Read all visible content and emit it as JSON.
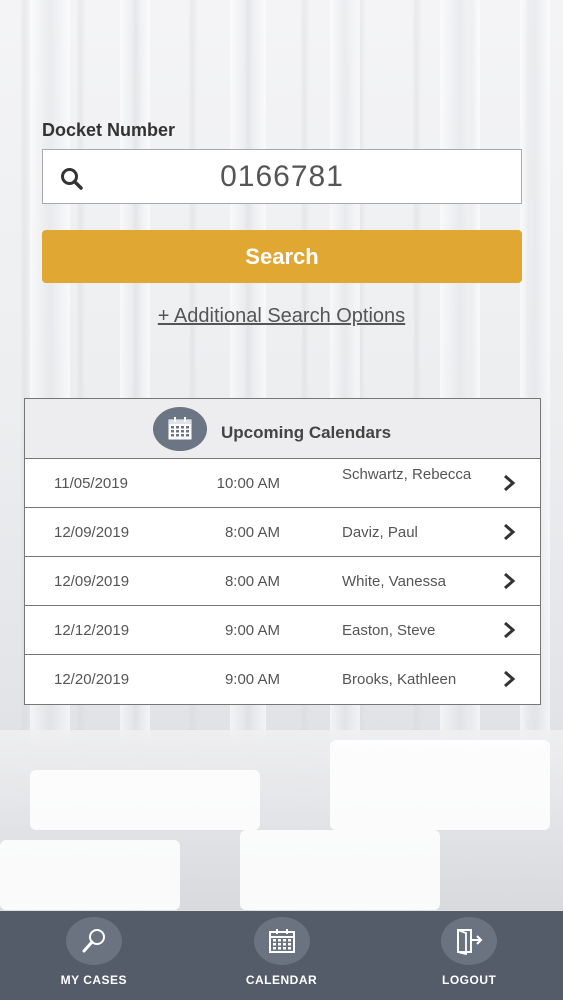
{
  "search": {
    "label": "Docket Number",
    "value": "0166781",
    "button_label": "Search",
    "additional_link": "+ Additional Search Options"
  },
  "calendar": {
    "title": "Upcoming Calendars",
    "rows": [
      {
        "date": "11/05/2019",
        "time": "10:00 AM",
        "name": "Schwartz, Rebecca"
      },
      {
        "date": "12/09/2019",
        "time": "8:00 AM",
        "name": "Daviz, Paul"
      },
      {
        "date": "12/09/2019",
        "time": "8:00 AM",
        "name": "White, Vanessa"
      },
      {
        "date": "12/12/2019",
        "time": "9:00 AM",
        "name": "Easton, Steve"
      },
      {
        "date": "12/20/2019",
        "time": "9:00 AM",
        "name": "Brooks, Kathleen"
      }
    ]
  },
  "nav": {
    "items": [
      {
        "label": "MY CASES",
        "icon": "magnifier-icon"
      },
      {
        "label": "CALENDAR",
        "icon": "calendar-icon"
      },
      {
        "label": "LOGOUT",
        "icon": "logout-icon"
      }
    ]
  },
  "colors": {
    "accent": "#e0a733",
    "nav_bg": "#545b69",
    "icon_circle": "#6c7583"
  }
}
